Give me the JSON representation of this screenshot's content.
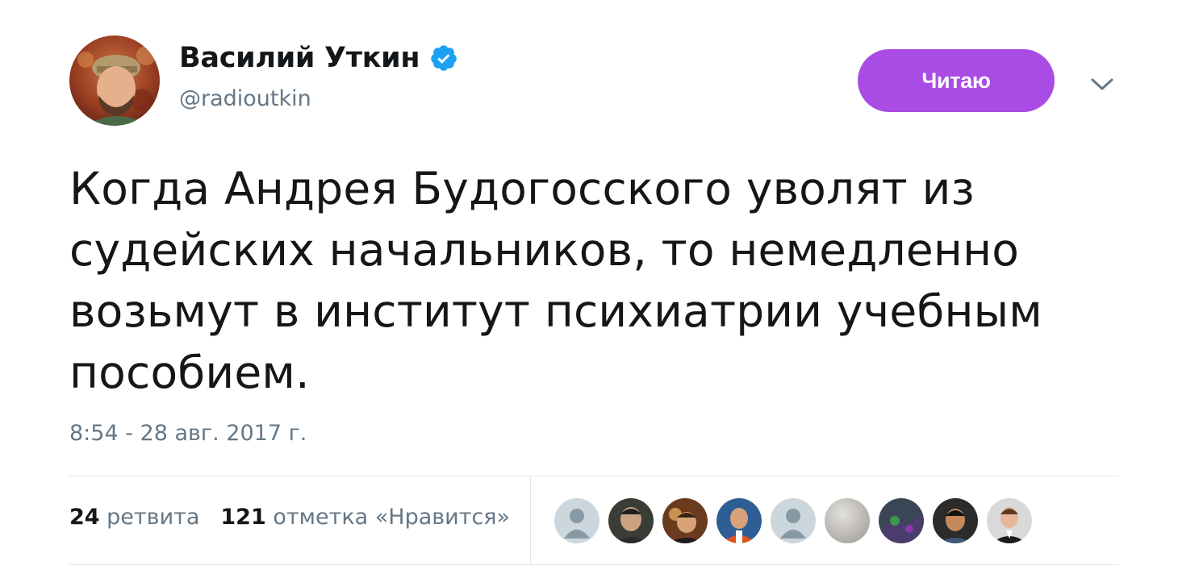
{
  "author": {
    "display_name": "Василий Уткин",
    "handle": "@radioutkin",
    "verified": true,
    "verified_icon": "verified-badge-icon"
  },
  "follow_button": {
    "label": "Читаю"
  },
  "menu": {
    "icon": "chevron-down-icon"
  },
  "tweet": {
    "text": "Когда Андрея Будогосского уволят из\nсудейских начальников, то немедленно\nвозьмут в институт психиатрии учебным\nпособием.",
    "timestamp": "8:54 - 28 авг. 2017 г."
  },
  "stats": {
    "retweets_count": "24",
    "retweets_label": "ретвита",
    "likes_count": "121",
    "likes_label": "отметка «Нравится»"
  },
  "likers": [
    {
      "kind": "default-avatar"
    },
    {
      "kind": "photo"
    },
    {
      "kind": "photo"
    },
    {
      "kind": "photo"
    },
    {
      "kind": "default-avatar"
    },
    {
      "kind": "photo"
    },
    {
      "kind": "photo"
    },
    {
      "kind": "photo"
    },
    {
      "kind": "photo"
    }
  ],
  "colors": {
    "accent_button": "#a94ce6",
    "verified_blue": "#1da1f2",
    "secondary_text": "#657786",
    "primary_text": "#14171a",
    "divider": "#e1e8ed"
  }
}
